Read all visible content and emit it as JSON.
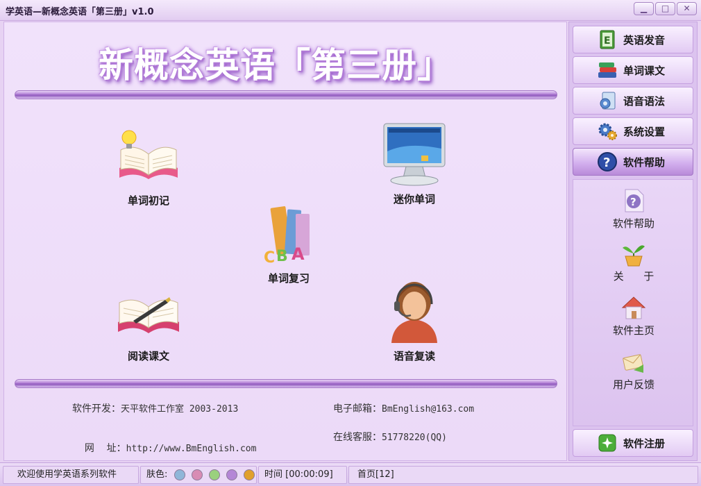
{
  "window": {
    "title": "学英语—新概念英语「第三册」v1.0",
    "minimize": "▁",
    "maximize": "□",
    "close": "✕"
  },
  "banner": {
    "text": "新概念英语「第三册」"
  },
  "functions": [
    {
      "label": "单词初记",
      "icon": "open-book-lightbulb-icon"
    },
    {
      "label": "迷你单词",
      "icon": "monitor-icon"
    },
    {
      "label": "单词复习",
      "icon": "abc-books-icon"
    },
    {
      "label": "阅读课文",
      "icon": "book-pen-icon"
    },
    {
      "label": "语音复读",
      "icon": "headset-operator-icon"
    }
  ],
  "info": {
    "developer_label": "软件开发：",
    "developer_value": "天平软件工作室 2003-2013",
    "email_label": "电子邮箱：",
    "email_value": "BmEnglish@163.com",
    "site_label": "网    址：",
    "site_value": "http://www.BmEnglish.com",
    "support_label": "在线客服：",
    "support_value": "51778220(QQ)"
  },
  "sidebar": {
    "nav": [
      {
        "label": "英语发音",
        "icon": "e-book-icon"
      },
      {
        "label": "单词课文",
        "icon": "books-stack-icon"
      },
      {
        "label": "语音语法",
        "icon": "speaker-document-icon"
      },
      {
        "label": "系统设置",
        "icon": "gears-icon"
      },
      {
        "label": "软件帮助",
        "icon": "question-circle-icon",
        "active": true
      }
    ],
    "sub_items": [
      {
        "label": "软件帮助",
        "icon": "help-document-icon"
      },
      {
        "label": "关      于",
        "icon": "plant-pot-icon"
      },
      {
        "label": "软件主页",
        "icon": "home-icon"
      },
      {
        "label": "用户反馈",
        "icon": "envelope-icon"
      }
    ],
    "register": {
      "label": "软件注册",
      "icon": "sparkle-icon"
    }
  },
  "statusbar": {
    "welcome": "欢迎使用学英语系列软件",
    "skin_label": "肤色:",
    "skin_colors": [
      "#8fb6d8",
      "#d88cb4",
      "#9ad07e",
      "#b486d6",
      "#e0a02c"
    ],
    "time": "时间 [00:00:09]",
    "page": "首页[12]"
  },
  "colors": {
    "accent": "#b07ad6",
    "panel": "#ecdaf8",
    "sidebar": "#dcc3ef"
  }
}
